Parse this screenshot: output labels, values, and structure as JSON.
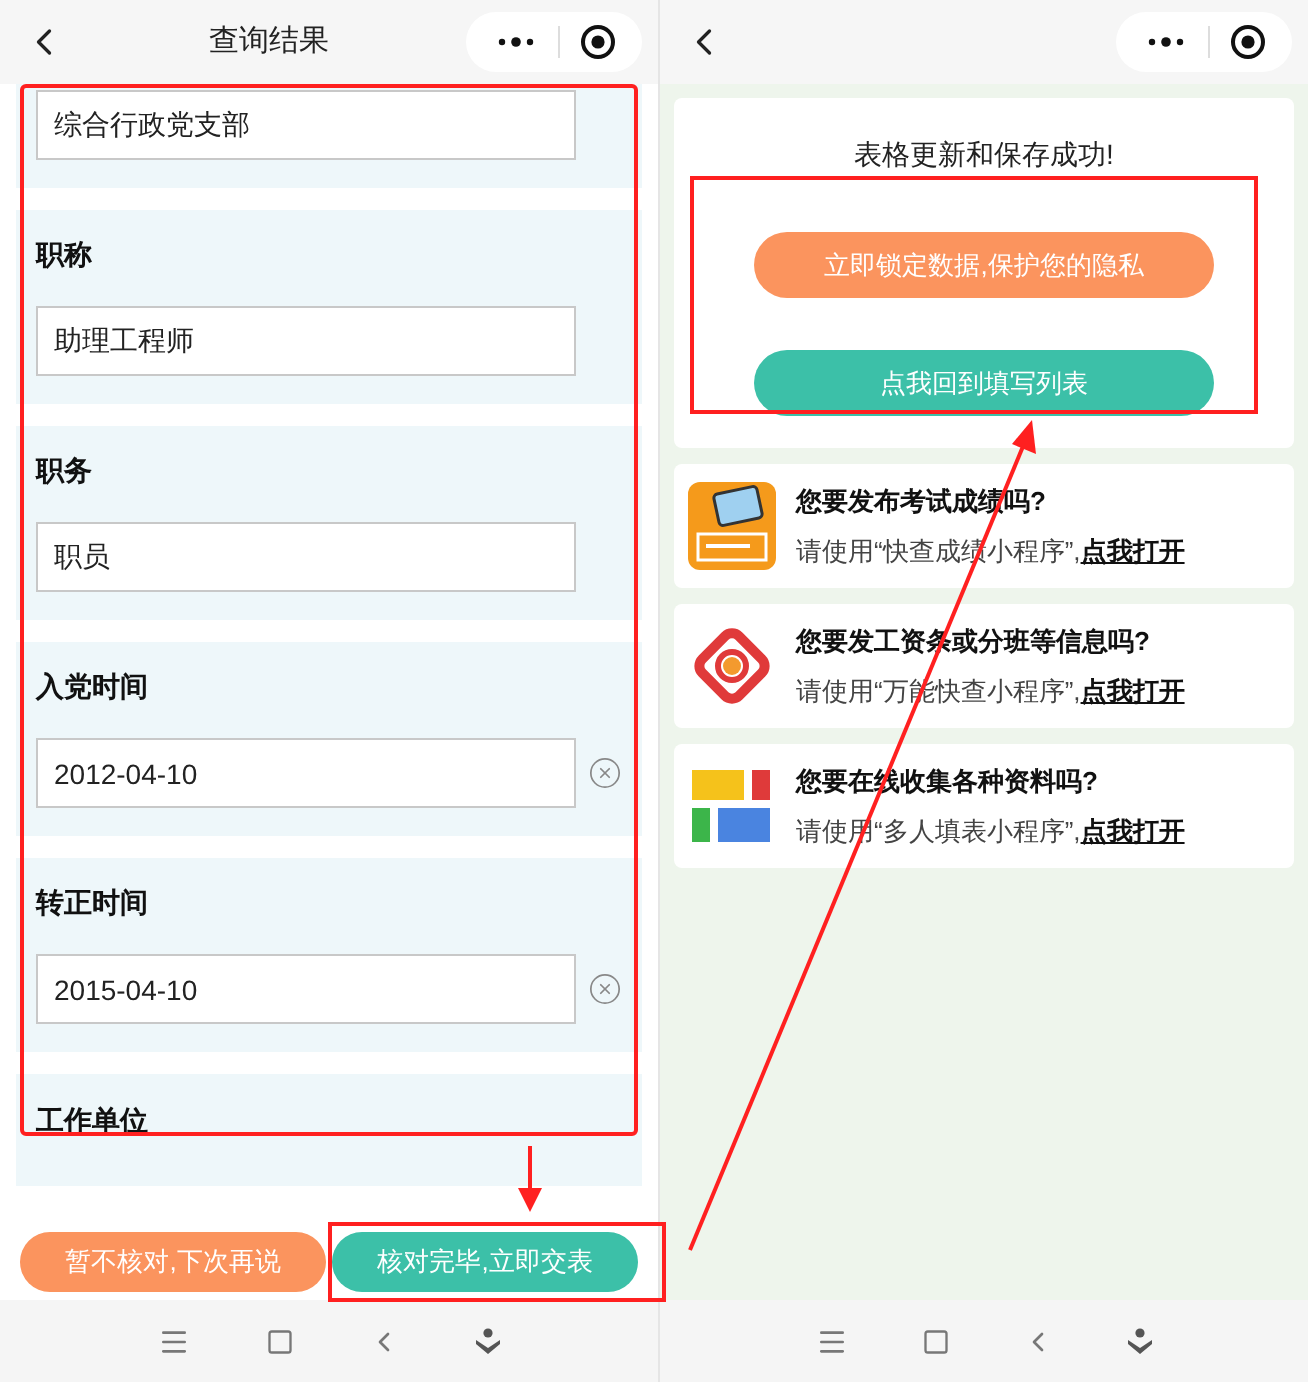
{
  "left_screen": {
    "title": "查询结果",
    "fields": [
      {
        "value": "综合行政党支部",
        "clearable": false
      },
      {
        "label": "职称",
        "value": "助理工程师",
        "clearable": false
      },
      {
        "label": "职务",
        "value": "职员",
        "clearable": false
      },
      {
        "label": "入党时间",
        "value": "2012-04-10",
        "clearable": true
      },
      {
        "label": "转正时间",
        "value": "2015-04-10",
        "clearable": true
      }
    ],
    "partial_field_label": "工作单位",
    "buttons": [
      {
        "label": "暂不核对,下次再说",
        "kind": "secondary"
      },
      {
        "label": "核对完毕,立即交表",
        "kind": "primary"
      }
    ]
  },
  "right_screen": {
    "message": "表格更新和保存成功!",
    "buttons": [
      {
        "label": "立即锁定数据,保护您的隐私",
        "kind": "secondary"
      },
      {
        "label": "点我回到填写列表",
        "kind": "primary"
      }
    ],
    "promos": [
      {
        "kind": "score",
        "title": "您要发布考试成绩吗?",
        "text": "请使用“快查成绩小程序”,",
        "link": "点我打开"
      },
      {
        "kind": "search",
        "title": "您要发工资条或分班等信息吗?",
        "text": "请使用“万能快查小程序”,",
        "link": "点我打开"
      },
      {
        "kind": "blocks",
        "title": "您要在线收集各种资料吗?",
        "text": "请使用“多人填表小程序”,",
        "link": "点我打开"
      }
    ]
  }
}
